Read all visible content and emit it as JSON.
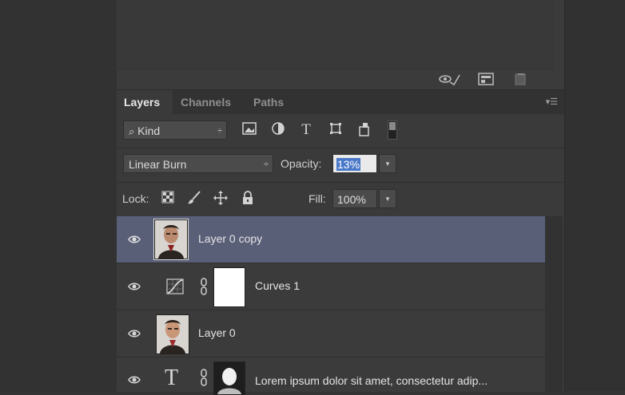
{
  "tabs": [
    "Layers",
    "Channels",
    "Paths"
  ],
  "filter": {
    "label": "Kind",
    "arrows": "÷"
  },
  "blend_mode": {
    "value": "Linear Burn",
    "arrows": "÷"
  },
  "opacity": {
    "label": "Opacity:",
    "value": "13%"
  },
  "lock": {
    "label": "Lock:"
  },
  "fill": {
    "label": "Fill:",
    "value": "100%"
  },
  "layers": [
    {
      "name": "Layer 0 copy",
      "selected": true
    },
    {
      "name": "Curves 1",
      "selected": false
    },
    {
      "name": "Layer 0",
      "selected": false
    },
    {
      "name": "Lorem ipsum dolor sit amet, consectetur adip...",
      "selected": false
    }
  ],
  "icons": {
    "panel_menu": "panel-menu-icon",
    "text_layer": "T"
  },
  "colors": {
    "selection": "#5a5f78",
    "opacity_highlight": "#4a78c8"
  }
}
